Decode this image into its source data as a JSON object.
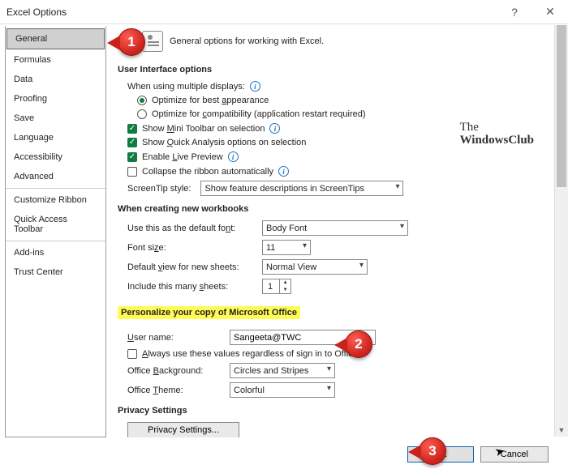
{
  "window": {
    "title": "Excel Options"
  },
  "sidebar": {
    "items": [
      {
        "label": "General",
        "selected": true
      },
      {
        "label": "Formulas"
      },
      {
        "label": "Data"
      },
      {
        "label": "Proofing"
      },
      {
        "label": "Save"
      },
      {
        "label": "Language"
      },
      {
        "label": "Accessibility"
      },
      {
        "label": "Advanced"
      }
    ],
    "items2": [
      {
        "label": "Customize Ribbon"
      },
      {
        "label": "Quick Access Toolbar"
      }
    ],
    "items3": [
      {
        "label": "Add-ins"
      },
      {
        "label": "Trust Center"
      }
    ]
  },
  "intro": "General options for working with Excel.",
  "sections": {
    "ui": {
      "heading": "User Interface options",
      "multiDisplays": "When using multiple displays:",
      "optBest": "Optimize for best appearance",
      "optCompat": "Optimize for compatibility (application restart required)",
      "showMini_pre": "Show ",
      "showMini_u": "M",
      "showMini_post": "ini Toolbar on selection",
      "showQA_pre": "Show ",
      "showQA_u": "Q",
      "showQA_post": "uick Analysis options on selection",
      "liveP_pre": "Enable ",
      "liveP_u": "L",
      "liveP_post": "ive Preview",
      "collapse_pre": "Collapse the ribbon automatically",
      "screentip_label": "ScreenTip style:",
      "screentip_value": "Show feature descriptions in ScreenTips"
    },
    "newwb": {
      "heading": "When creating new workbooks",
      "defFont_label": "Use this as the default font:",
      "defFont_value": "Body Font",
      "fontSize_label": "Font size:",
      "fontSize_value": "11",
      "defView_label": "Default view for new sheets:",
      "defView_value": "Normal View",
      "sheets_label": "Include this many sheets:",
      "sheets_value": "1"
    },
    "pers": {
      "heading": "Personalize your copy of Microsoft Office",
      "user_label": "User name:",
      "user_value": "Sangeeta@TWC",
      "always_pre": "",
      "always_u": "A",
      "always_post": "lways use these values regardless of sign in to Office.",
      "bg_label": "Office Background:",
      "bg_value": "Circles and Stripes",
      "theme_label": "Office Theme:",
      "theme_value": "Colorful"
    },
    "priv": {
      "heading": "Privacy Settings",
      "btn": "Privacy Settings..."
    }
  },
  "footer": {
    "ok": "OK",
    "cancel": "Cancel"
  },
  "watermark": {
    "line1": "The",
    "line2": "WindowsClub"
  },
  "badges": {
    "b1": "1",
    "b2": "2",
    "b3": "3"
  }
}
